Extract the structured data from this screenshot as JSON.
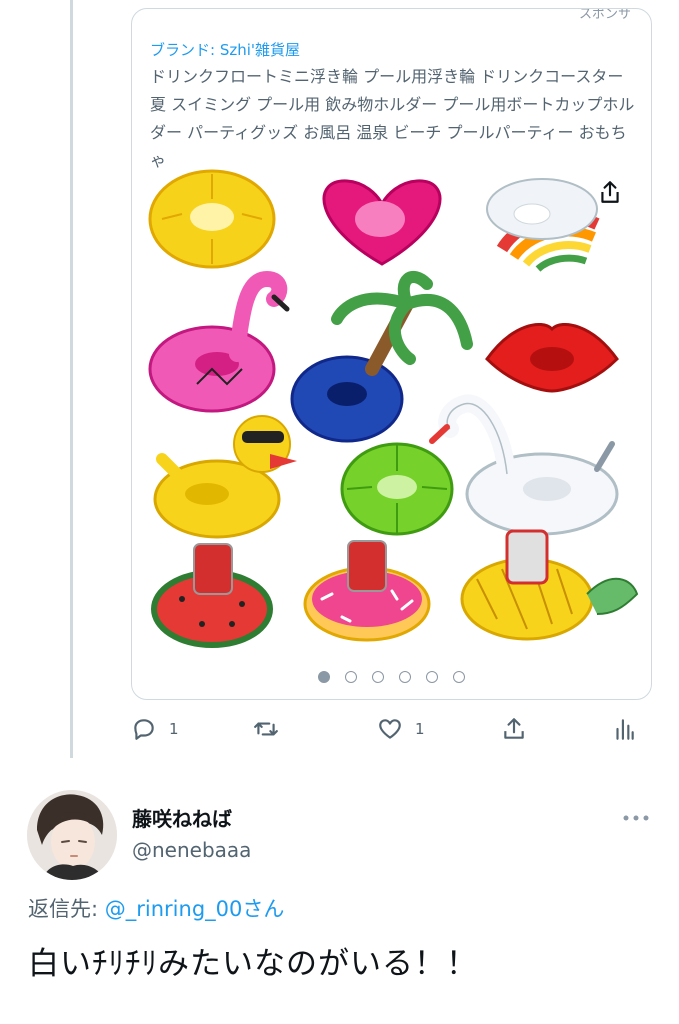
{
  "ad": {
    "sponsor_label": "スポンサ",
    "brand_label": "ブランド: Szhi'雑貨屋",
    "description": "ドリンクフロートミニ浮き輪 プール用浮き輪 ドリンクコースター 夏 スイミング プール用 飲み物ホルダー プール用ボートカップホルダー パーティグッズ お風呂 温泉 ビーチ プールパーティー おもちゃ",
    "share_icon": "share-icon",
    "carousel": {
      "total": 6,
      "active_index": 0
    },
    "products": [
      "pineapple-slice",
      "heart",
      "rainbow-cloud",
      "flamingo",
      "palm-tree",
      "lips",
      "duck",
      "lime",
      "swan",
      "watermelon",
      "donut",
      "pineapple"
    ]
  },
  "actions": {
    "reply_count": "1",
    "retweet_count": "",
    "like_count": "1",
    "icons": [
      "reply-icon",
      "retweet-icon",
      "like-icon",
      "share-icon",
      "analytics-icon"
    ]
  },
  "reply_tweet": {
    "display_name": "藤咲ねねば",
    "handle": "@nenebaaa",
    "reply_to_label": "返信先: ",
    "reply_to_mention": "@_rinring_00さん",
    "text": "白いﾁﾘﾁﾘみたいなのがいる！！"
  },
  "colors": {
    "accent": "#1d9bf0",
    "muted": "#536471",
    "border": "#cfd9de"
  }
}
